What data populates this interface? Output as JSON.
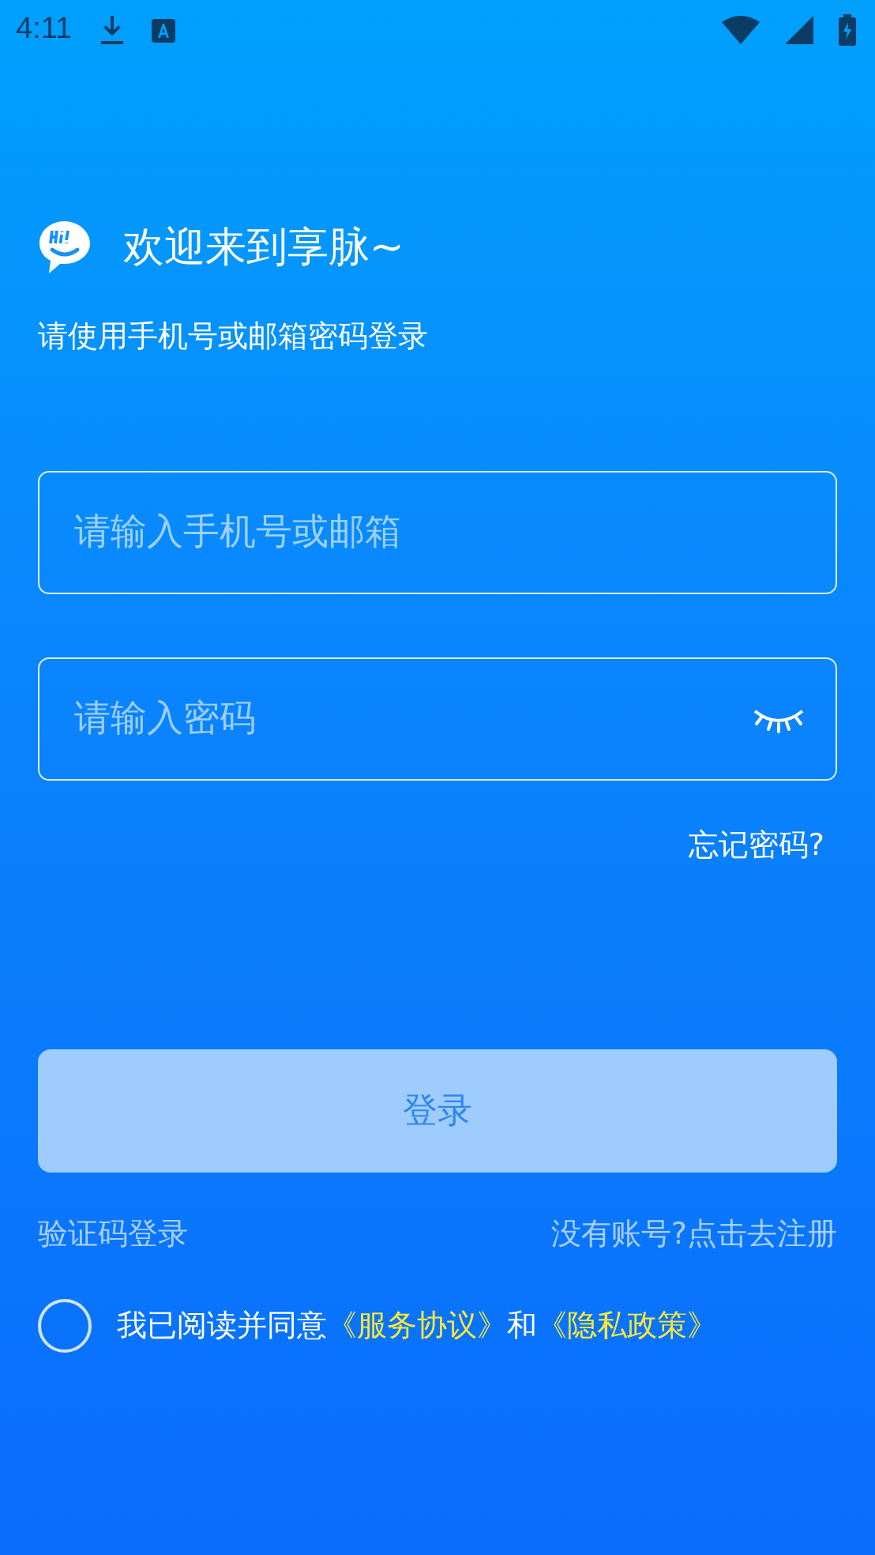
{
  "status_bar": {
    "time": "4:11"
  },
  "welcome": {
    "title": "欢迎来到享脉~",
    "subtitle": "请使用手机号或邮箱密码登录"
  },
  "account_field": {
    "placeholder": "请输入手机号或邮箱"
  },
  "password_field": {
    "placeholder": "请输入密码"
  },
  "forgot_link": "忘记密码?",
  "login_button": {
    "label": "登录",
    "disabled": true
  },
  "sms_login_link": "验证码登录",
  "register_link": "没有账号?点击去注册",
  "agreement": {
    "checked": false,
    "parts": [
      {
        "kind": "text",
        "text": "我已阅读并同意"
      },
      {
        "kind": "link",
        "text": "《服务协议》"
      },
      {
        "kind": "text",
        "text": "和"
      },
      {
        "kind": "link",
        "text": "《隐私政策》"
      }
    ]
  }
}
